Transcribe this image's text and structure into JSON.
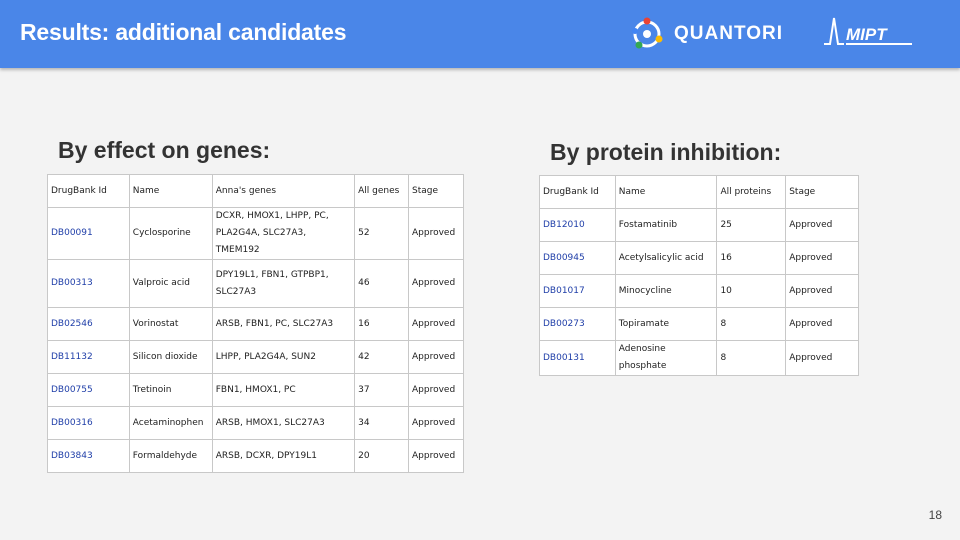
{
  "header": {
    "title": "Results: additional candidates",
    "quantori_logo_text": "QUANTORI",
    "mipt_logo_text": "MIPT"
  },
  "genes_section": {
    "title": "By effect on genes:",
    "columns": [
      "DrugBank Id",
      "Name",
      "Anna's genes",
      "All genes",
      "Stage"
    ],
    "rows": [
      {
        "id": "DB00091",
        "name": "Cyclosporine",
        "genes": "DCXR, HMOX1, LHPP, PC, PLA2G4A, SLC27A3, TMEM192",
        "all": "52",
        "stage": "Approved"
      },
      {
        "id": "DB00313",
        "name": "Valproic acid",
        "genes": "DPY19L1, FBN1, GTPBP1, SLC27A3",
        "all": "46",
        "stage": "Approved"
      },
      {
        "id": "DB02546",
        "name": "Vorinostat",
        "genes": "ARSB, FBN1, PC, SLC27A3",
        "all": "16",
        "stage": "Approved"
      },
      {
        "id": "DB11132",
        "name": "Silicon dioxide",
        "genes": "LHPP, PLA2G4A, SUN2",
        "all": "42",
        "stage": "Approved"
      },
      {
        "id": "DB00755",
        "name": "Tretinoin",
        "genes": "FBN1, HMOX1, PC",
        "all": "37",
        "stage": "Approved"
      },
      {
        "id": "DB00316",
        "name": "Acetaminophen",
        "genes": "ARSB, HMOX1, SLC27A3",
        "all": "34",
        "stage": "Approved"
      },
      {
        "id": "DB03843",
        "name": "Formaldehyde",
        "genes": "ARSB, DCXR, DPY19L1",
        "all": "20",
        "stage": "Approved"
      }
    ]
  },
  "protein_section": {
    "title": "By protein inhibition:",
    "columns": [
      "DrugBank Id",
      "Name",
      "All proteins",
      "Stage"
    ],
    "rows": [
      {
        "id": "DB12010",
        "name": "Fostamatinib",
        "all": "25",
        "stage": "Approved"
      },
      {
        "id": "DB00945",
        "name": "Acetylsalicylic acid",
        "all": "16",
        "stage": "Approved"
      },
      {
        "id": "DB01017",
        "name": "Minocycline",
        "all": "10",
        "stage": "Approved"
      },
      {
        "id": "DB00273",
        "name": "Topiramate",
        "all": "8",
        "stage": "Approved"
      },
      {
        "id": "DB00131",
        "name": "Adenosine phosphate",
        "all": "8",
        "stage": "Approved"
      }
    ]
  },
  "page_number": "18",
  "colors": {
    "header_bg": "#4a86e8",
    "link_id": "#1f3ea8",
    "quantori_dots": [
      "#ea4335",
      "#fbbc05",
      "#34a853",
      "#4285f4"
    ]
  }
}
